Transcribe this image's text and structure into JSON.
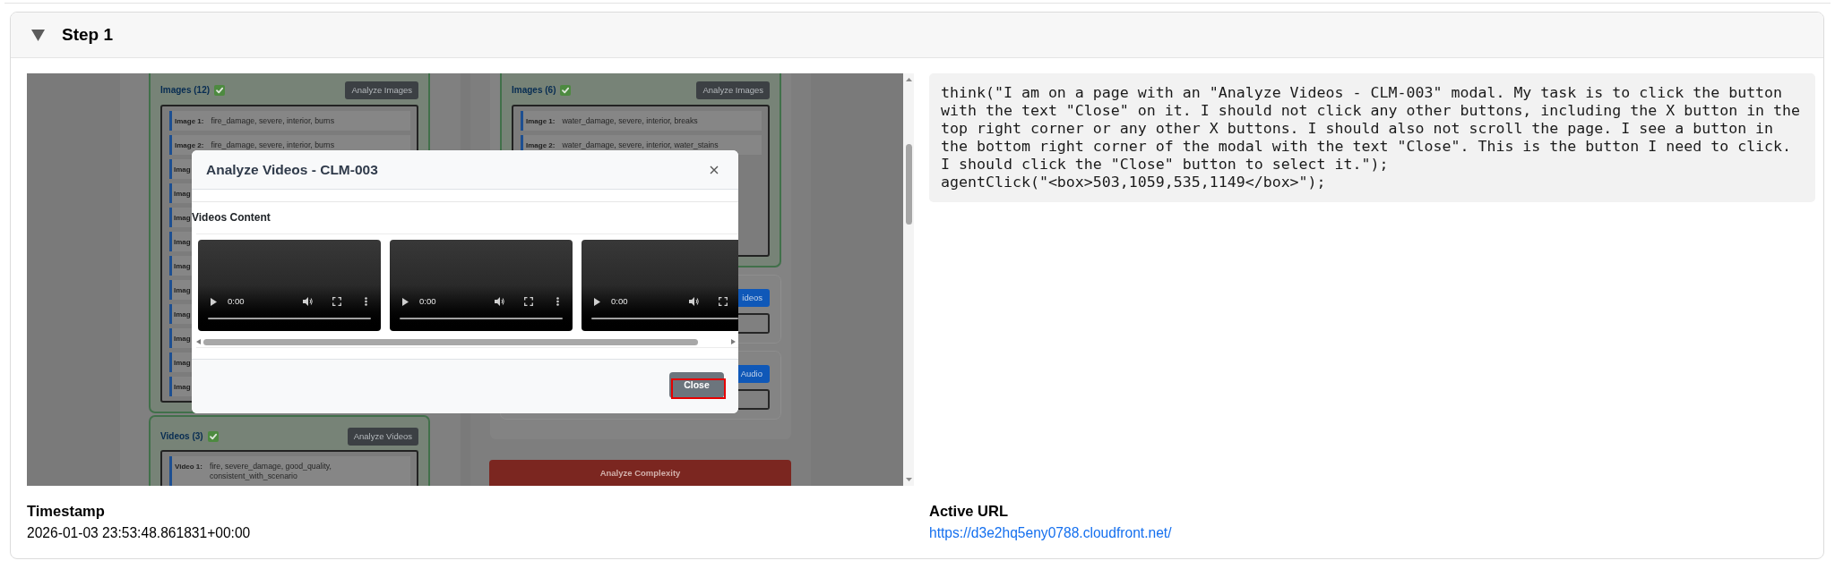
{
  "step": {
    "title": "Step 1",
    "expanded": true
  },
  "screenshot": {
    "left_cards": [
      {
        "title": "Images (12)",
        "verified": true,
        "button": "Analyze Images",
        "items": [
          {
            "label": "Image 1:",
            "value": "fire_damage, severe, interior, burns",
            "covered": false
          },
          {
            "label": "Image 2:",
            "value": "fire_damage, severe, interior, burns",
            "covered": false
          },
          {
            "label": "Imag",
            "covered": true
          },
          {
            "label": "Imag",
            "covered": true
          },
          {
            "label": "Imag",
            "covered": true
          },
          {
            "label": "Imag",
            "covered": true
          },
          {
            "label": "Imag",
            "covered": true
          },
          {
            "label": "Imag",
            "covered": true
          },
          {
            "label": "Imag",
            "covered": true
          },
          {
            "label": "Imag",
            "covered": true
          },
          {
            "label": "Imag",
            "covered": true
          },
          {
            "label": "Imag",
            "covered": true
          }
        ]
      },
      {
        "title": "Videos (3)",
        "verified": true,
        "button": "Analyze Videos",
        "items": [
          {
            "label": "Video 1:",
            "value": "fire, severe_damage, good_quality, consistent_with_scenario",
            "covered": false
          }
        ]
      }
    ],
    "right_image_card": {
      "title": "Images (6)",
      "verified": true,
      "button": "Analyze Images",
      "items": [
        {
          "label": "Image 1:",
          "value": "water_damage, severe, interior, breaks",
          "covered": false
        },
        {
          "label": "Image 2:",
          "value": "water_damage, severe, interior, water_stains",
          "covered": false
        }
      ]
    },
    "upload_cards": [
      {
        "button": "ideos"
      },
      {
        "button": "Audio"
      }
    ],
    "complexity_button": "Analyze Complexity",
    "modal": {
      "title": "Analyze Videos - CLM-003",
      "section_title": "Videos Content",
      "videos": [
        {
          "time": "0:00",
          "cut_off": false
        },
        {
          "time": "0:00",
          "cut_off": false
        },
        {
          "time": "0:00",
          "cut_off": true
        }
      ],
      "close_button": {
        "label": "Close",
        "highlighted": true
      }
    }
  },
  "agent_code": "think(\"I am on a page with an \"Analyze Videos - CLM-003\" modal. My task is to click the button with the text \"Close\" on it. I should not click any other buttons, including the X button in the top right corner or any other X buttons. I should also not scroll the page. I see a button in the bottom right corner of the modal with the text \"Close\". This is the button I need to click. I should click the \"Close\" button to select it.\");\nagentClick(\"<box>503,1059,535,1149</box>\");",
  "timestamp": {
    "label": "Timestamp",
    "value": "2026-01-03 23:53:48.861831+00:00"
  },
  "active_url": {
    "label": "Active URL",
    "value": "https://d3e2hq5eny0788.cloudfront.net/"
  }
}
